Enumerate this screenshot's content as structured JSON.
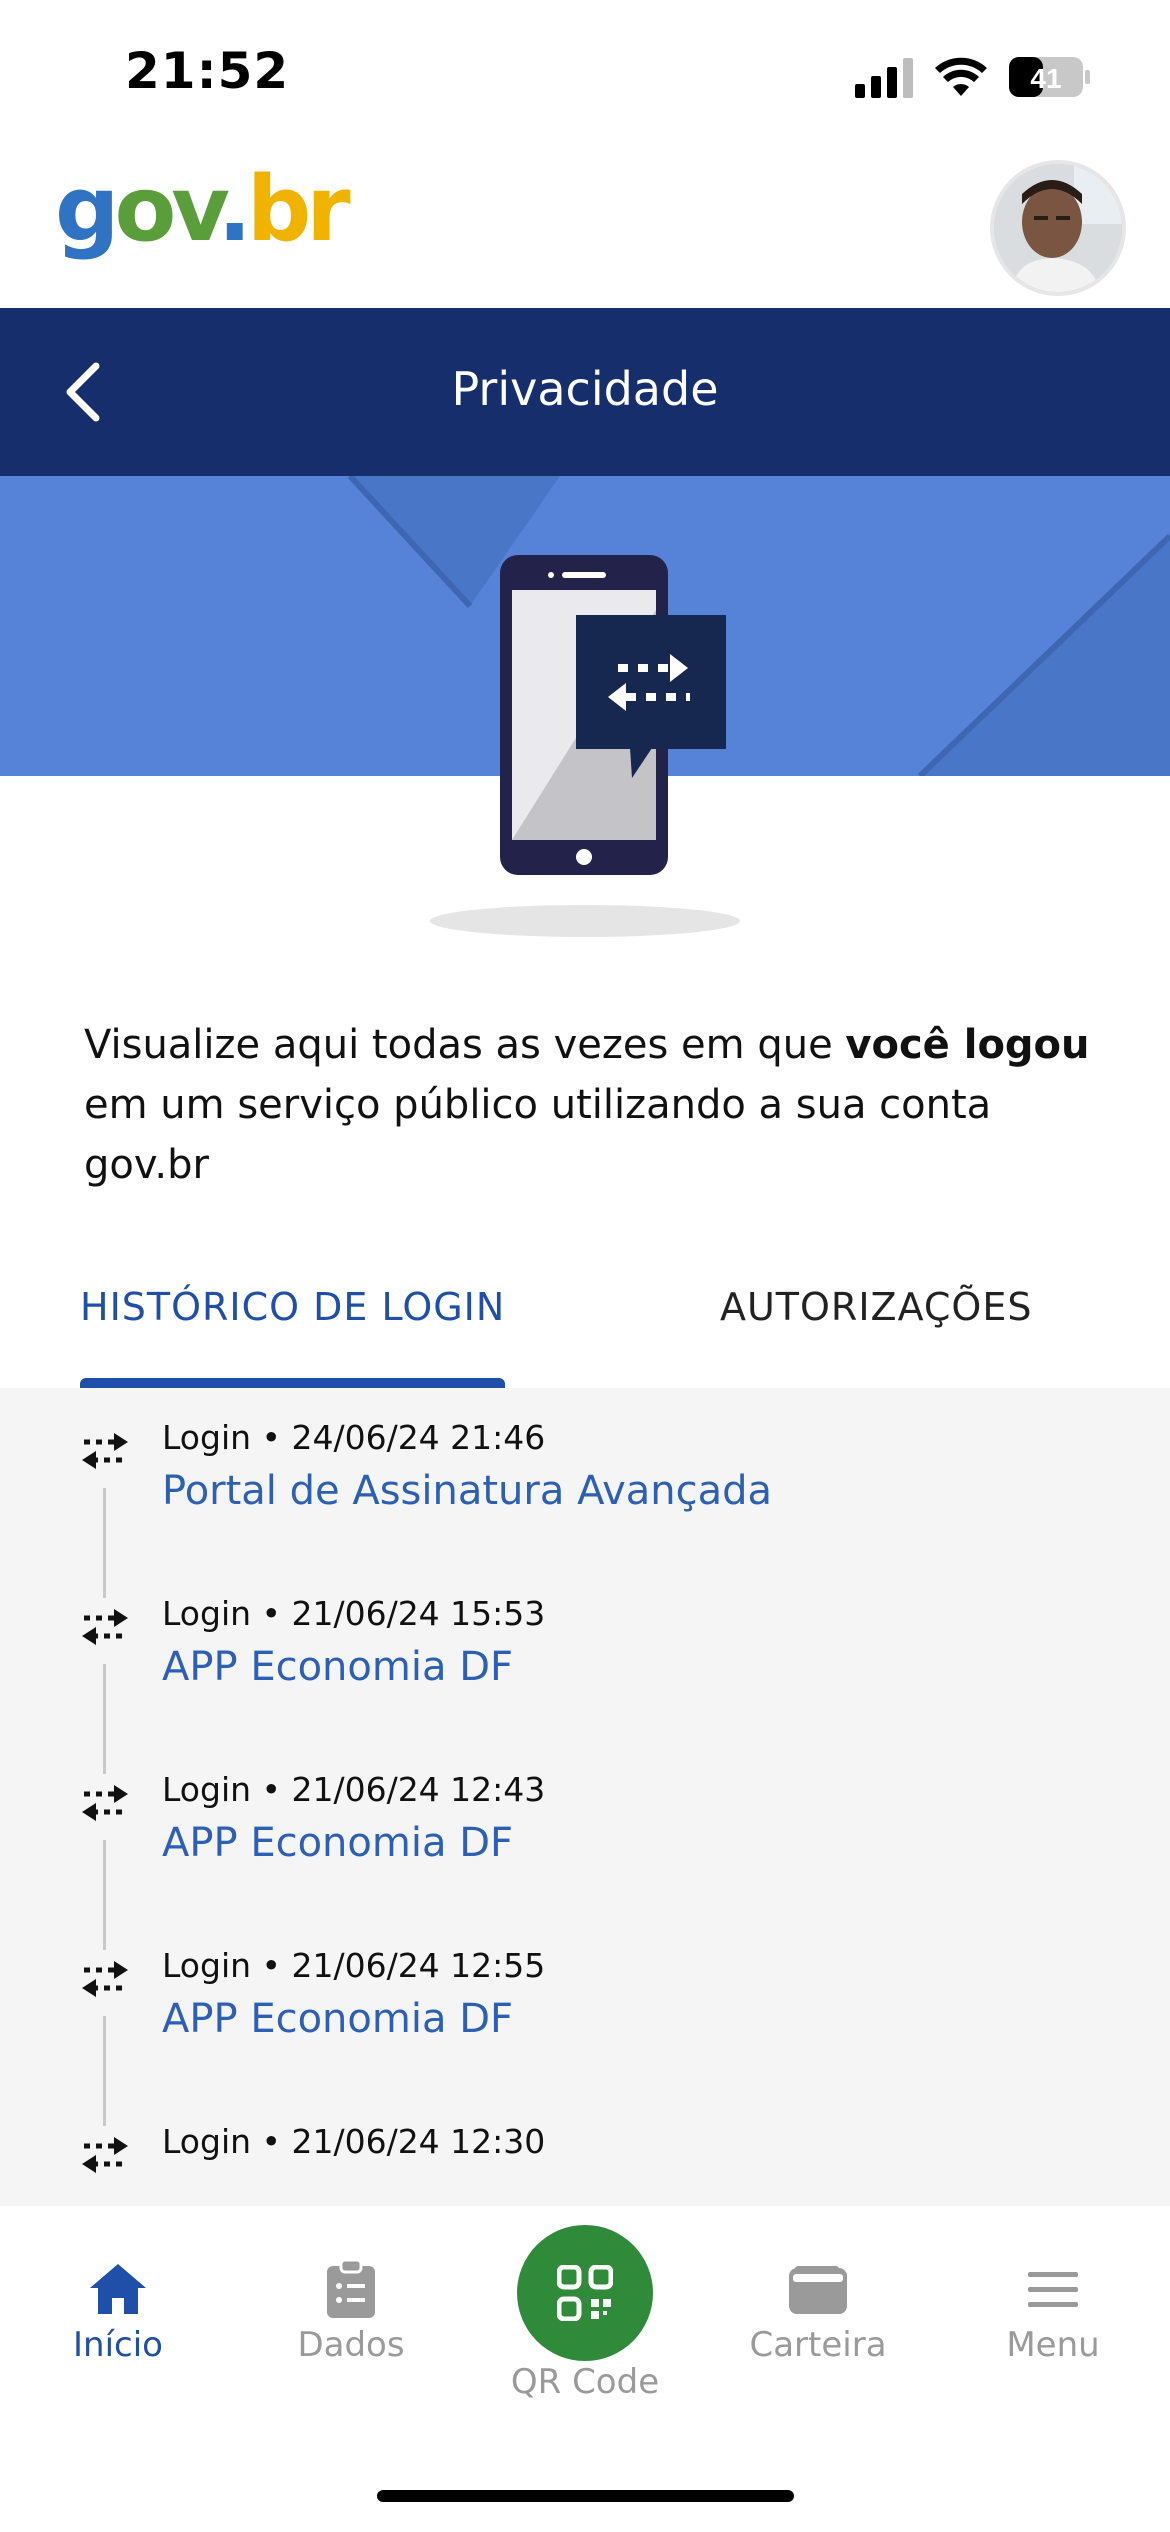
{
  "status_bar": {
    "time": "21:52",
    "battery": "41"
  },
  "logo": {
    "g": "g",
    "o": "o",
    "v": "v",
    "dot": ".",
    "b": "b",
    "r": "r"
  },
  "header": {
    "title": "Privacidade"
  },
  "description": {
    "part1": "Visualize aqui todas as vezes em que ",
    "bold": "você logou",
    "part2": " em um serviço público utilizando a sua conta gov.br"
  },
  "tabs": [
    {
      "label": "HISTÓRICO DE LOGIN",
      "active": true
    },
    {
      "label": "AUTORIZAÇÕES",
      "active": false
    }
  ],
  "login_history": [
    {
      "meta": "Login • 24/06/24 21:46",
      "service": "Portal de Assinatura Avançada"
    },
    {
      "meta": "Login • 21/06/24 15:53",
      "service": "APP Economia DF"
    },
    {
      "meta": "Login • 21/06/24 12:43",
      "service": "APP Economia DF"
    },
    {
      "meta": "Login • 21/06/24 12:55",
      "service": "APP Economia DF"
    },
    {
      "meta": "Login • 21/06/24 12:30",
      "service": ""
    }
  ],
  "bottom_nav": [
    {
      "label": "Início",
      "icon": "home-icon",
      "active": true
    },
    {
      "label": "Dados",
      "icon": "clipboard-icon",
      "active": false
    },
    {
      "label": "QR Code",
      "icon": "qr-code-icon",
      "active": false
    },
    {
      "label": "Carteira",
      "icon": "wallet-icon",
      "active": false
    },
    {
      "label": "Menu",
      "icon": "menu-icon",
      "active": false
    }
  ],
  "colors": {
    "header_bg": "#162f6c",
    "banner_bg": "#5683d7",
    "accent_blue": "#1f4fa8",
    "qr_green": "#2f8a3a"
  }
}
